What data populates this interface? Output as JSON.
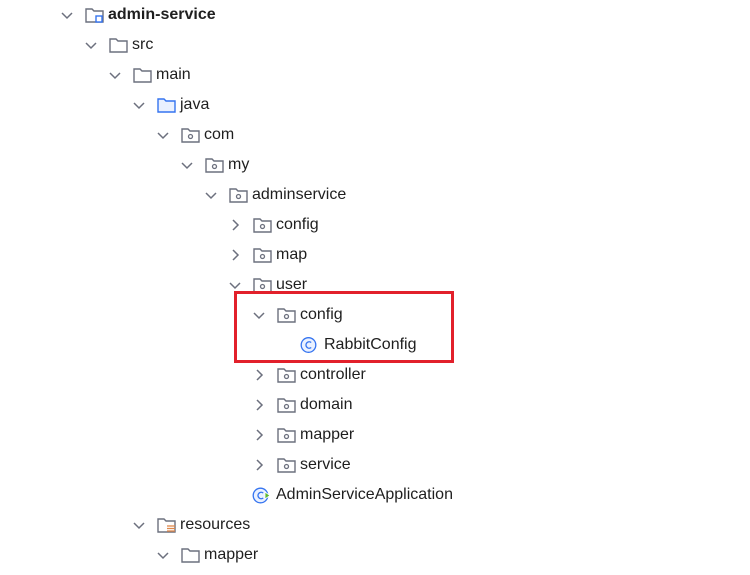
{
  "tree": {
    "items": [
      {
        "label": "admin-service",
        "icon": "module-folder-icon",
        "expanded": true
      },
      {
        "label": "src",
        "icon": "folder-icon",
        "expanded": true
      },
      {
        "label": "main",
        "icon": "folder-icon",
        "expanded": true
      },
      {
        "label": "java",
        "icon": "source-folder-icon",
        "expanded": true
      },
      {
        "label": "com",
        "icon": "package-icon",
        "expanded": true
      },
      {
        "label": "my",
        "icon": "package-icon",
        "expanded": true
      },
      {
        "label": "adminservice",
        "icon": "package-icon",
        "expanded": true
      },
      {
        "label": "config",
        "icon": "package-icon",
        "expanded": false
      },
      {
        "label": "map",
        "icon": "package-icon",
        "expanded": false
      },
      {
        "label": "user",
        "icon": "package-icon",
        "expanded": true
      },
      {
        "label": "config",
        "icon": "package-icon",
        "expanded": true
      },
      {
        "label": "RabbitConfig",
        "icon": "class-icon"
      },
      {
        "label": "controller",
        "icon": "package-icon",
        "expanded": false
      },
      {
        "label": "domain",
        "icon": "package-icon",
        "expanded": false
      },
      {
        "label": "mapper",
        "icon": "package-icon",
        "expanded": false
      },
      {
        "label": "service",
        "icon": "package-icon",
        "expanded": false
      },
      {
        "label": "AdminServiceApplication",
        "icon": "spring-boot-app-icon"
      },
      {
        "label": "resources",
        "icon": "resources-folder-icon",
        "expanded": true
      },
      {
        "label": "mapper",
        "icon": "folder-icon",
        "expanded": true
      }
    ]
  },
  "colors": {
    "highlight": "#e2202b",
    "folder_stroke": "#6c707e",
    "source_folder": "#3574f0",
    "class_icon": "#3574f0",
    "resources_lines": "#e0884a"
  }
}
